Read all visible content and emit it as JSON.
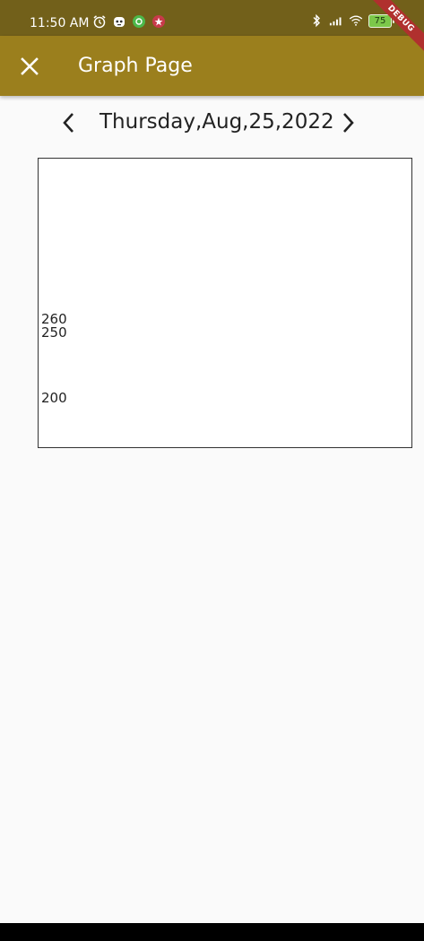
{
  "status_bar": {
    "time": "11:50 AM",
    "battery": "75",
    "icons_left": [
      "alarm-icon",
      "robot-icon",
      "green-app-icon",
      "red-app-icon"
    ],
    "icons_right": [
      "bluetooth-icon",
      "signal-icon",
      "wifi-icon",
      "battery-icon"
    ]
  },
  "debug_banner": "DEBUG",
  "app_bar": {
    "title": "Graph Page",
    "close_icon": "close-icon",
    "background": "#9b7f1d"
  },
  "date_nav": {
    "date": "Thursday,Aug,25,2022",
    "prev_icon": "chevron-left-icon",
    "next_icon": "chevron-right-icon"
  },
  "graph": {
    "labels": [
      "260",
      "250",
      "200"
    ]
  }
}
